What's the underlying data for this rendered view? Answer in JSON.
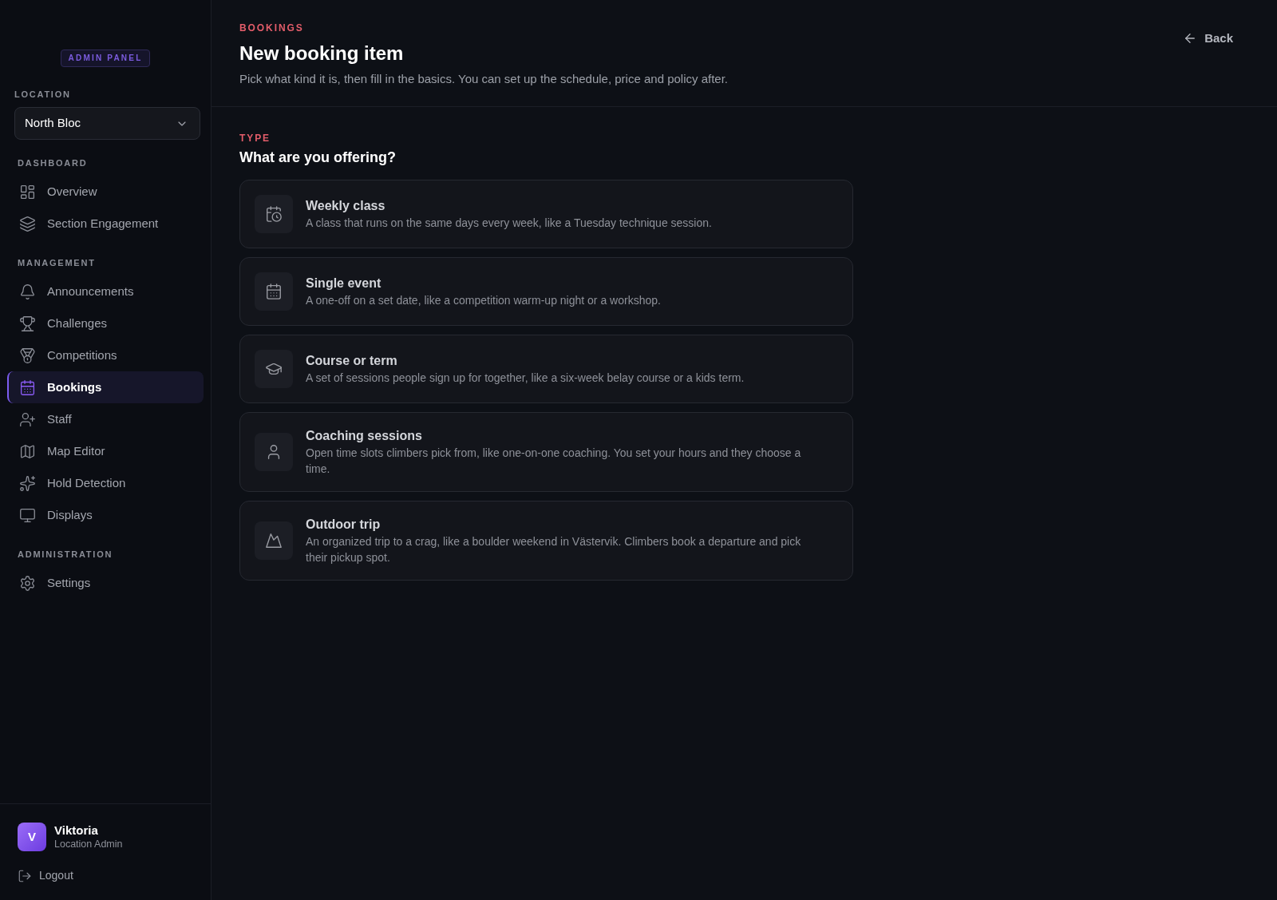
{
  "sidebar": {
    "badge": "ADMIN PANEL",
    "location": {
      "label": "LOCATION",
      "value": "North Bloc"
    },
    "sections": [
      {
        "title": "DASHBOARD",
        "items": [
          {
            "kind": "overview",
            "label": "Overview",
            "selected": false
          },
          {
            "kind": "engagement",
            "label": "Section Engagement",
            "selected": false
          }
        ]
      },
      {
        "title": "MANAGEMENT",
        "items": [
          {
            "kind": "announcements",
            "label": "Announcements",
            "selected": false
          },
          {
            "kind": "challenges",
            "label": "Challenges",
            "selected": false
          },
          {
            "kind": "competitions",
            "label": "Competitions",
            "selected": false
          },
          {
            "kind": "bookings",
            "label": "Bookings",
            "selected": true
          },
          {
            "kind": "staff",
            "label": "Staff",
            "selected": false
          },
          {
            "kind": "map",
            "label": "Map Editor",
            "selected": false
          },
          {
            "kind": "detection",
            "label": "Hold Detection",
            "selected": false
          },
          {
            "kind": "displays",
            "label": "Displays",
            "selected": false
          }
        ]
      },
      {
        "title": "ADMINISTRATION",
        "items": [
          {
            "kind": "settings",
            "label": "Settings",
            "selected": false
          }
        ]
      }
    ],
    "user": {
      "initial": "V",
      "name": "Viktoria",
      "role": "Location Admin"
    },
    "logout": "Logout"
  },
  "header": {
    "eyebrow": "BOOKINGS",
    "title": "New booking item",
    "subtitle": "Pick what kind it is, then fill in the basics. You can set up the schedule, price and policy after.",
    "back": "Back"
  },
  "type_picker": {
    "eyebrow": "TYPE",
    "title": "What are you offering?",
    "options": [
      {
        "kind": "weekly",
        "title": "Weekly class",
        "description": "A class that runs on the same days every week, like a Tuesday technique session."
      },
      {
        "kind": "event",
        "title": "Single event",
        "description": "A one-off on a set date, like a competition warm-up night or a workshop."
      },
      {
        "kind": "course",
        "title": "Course or term",
        "description": "A set of sessions people sign up for together, like a six-week belay course or a kids term."
      },
      {
        "kind": "coaching",
        "title": "Coaching sessions",
        "description": "Open time slots climbers pick from, like one-on-one coaching. You set your hours and they choose a time."
      },
      {
        "kind": "trip",
        "title": "Outdoor trip",
        "description": "An organized trip to a crag, like a boulder weekend in Västervik. Climbers book a departure and pick their pickup spot."
      }
    ]
  }
}
